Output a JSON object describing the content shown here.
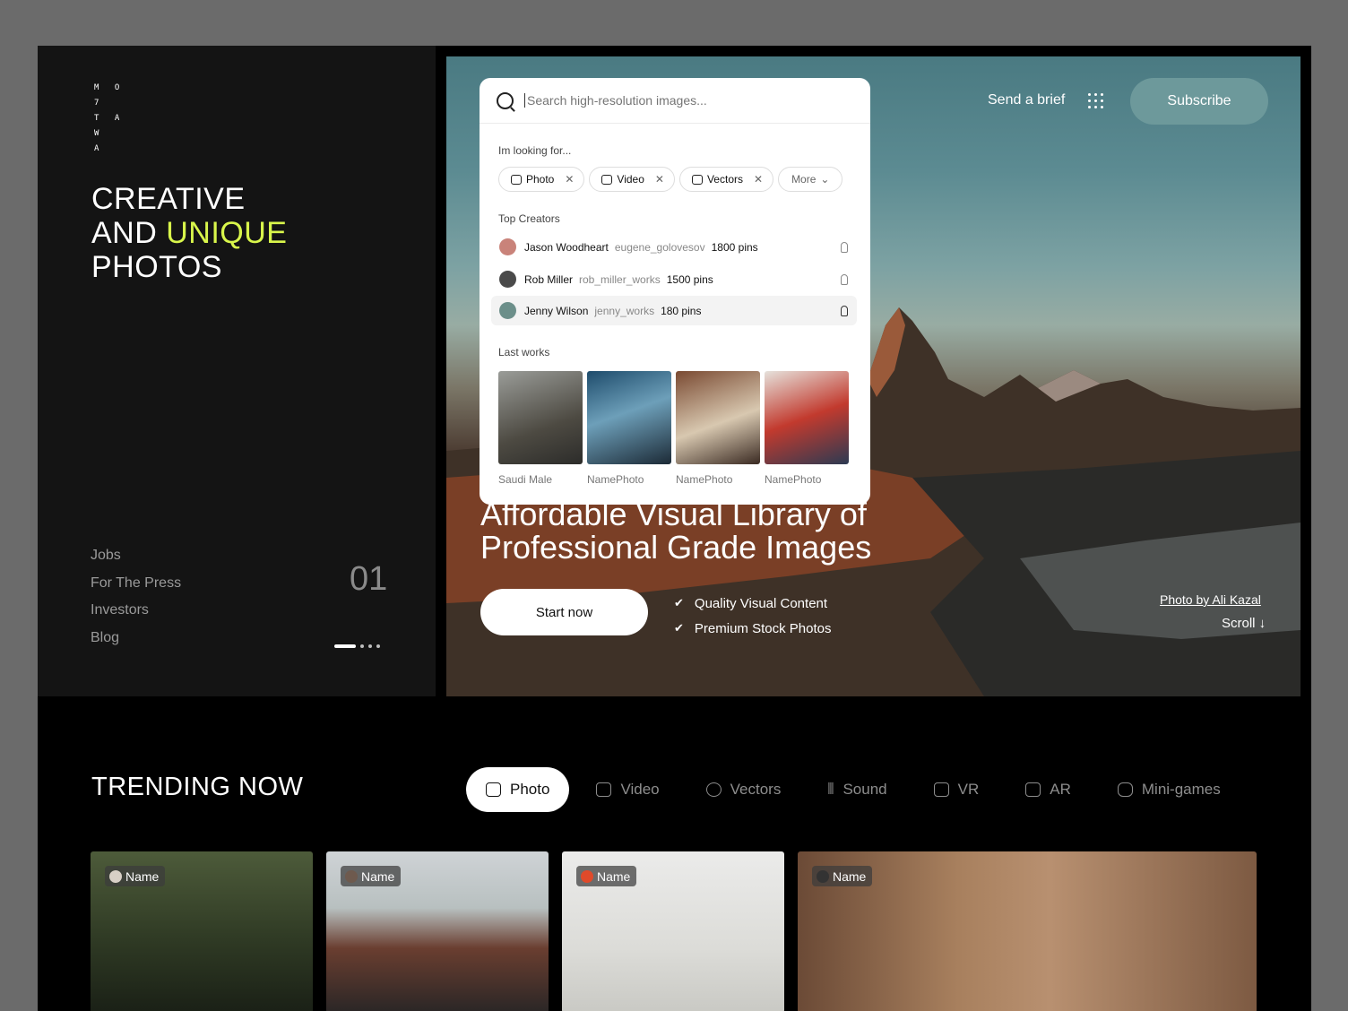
{
  "brand": {
    "logo_lines": [
      "M O 7",
      "T A W",
      "A"
    ]
  },
  "hero_left": {
    "title_line1": "CREATIVE",
    "title_line2_prefix": "AND ",
    "title_line2_accent": "UNIQUE",
    "title_line3": "PHOTOS",
    "links": [
      "Jobs",
      "For The Press",
      "Investors",
      "Blog"
    ],
    "slide_number": "01"
  },
  "top_nav": {
    "send_brief": "Send a brief",
    "subscribe": "Subscribe"
  },
  "search": {
    "placeholder": "Search high-resolution images...",
    "looking_for_label": "Im looking for...",
    "chips": [
      "Photo",
      "Video",
      "Vectors"
    ],
    "more_label": "More",
    "top_creators_label": "Top Creators",
    "creators": [
      {
        "name": "Jason Woodheart",
        "handle": "eugene_golovesov",
        "pins": "1800 pins"
      },
      {
        "name": "Rob Miller",
        "handle": "rob_miller_works",
        "pins": "1500 pins"
      },
      {
        "name": "Jenny Wilson",
        "handle": "jenny_works",
        "pins": "180 pins"
      }
    ],
    "last_works_label": "Last works",
    "works": [
      "Saudi Male",
      "NamePhoto",
      "NamePhoto",
      "NamePhoto"
    ]
  },
  "hero": {
    "headline_line1": "Affordable Visual Library of",
    "headline_line2": "Professional Grade Images",
    "start_button": "Start now",
    "features": [
      "Quality Visual Content",
      "Premium Stock Photos"
    ],
    "credit": "Photo by Ali Kazal",
    "scroll": "Scroll ↓"
  },
  "trending": {
    "title": "TRENDING NOW",
    "tabs": [
      "Photo",
      "Video",
      "Vectors",
      "Sound",
      "VR",
      "AR",
      "Mini-games"
    ],
    "cards": [
      "Name",
      "Name",
      "Name",
      "Name"
    ]
  },
  "colors": {
    "accent": "#d9f64b",
    "subscribe_bg": "#6d999b",
    "panel": "#141414"
  }
}
